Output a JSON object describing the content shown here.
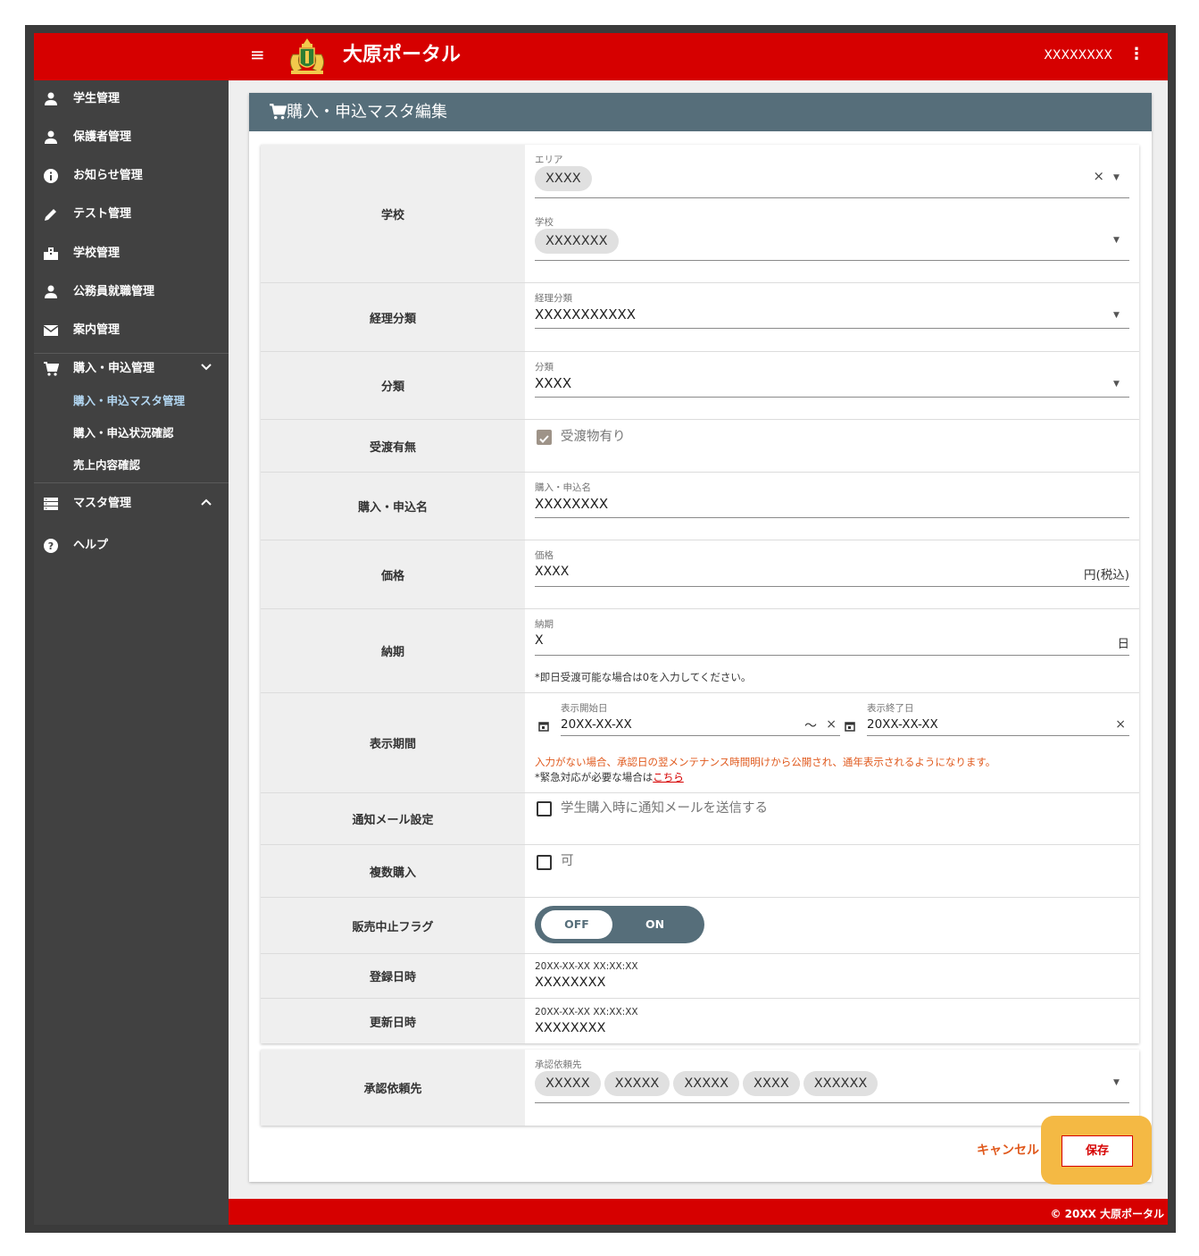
{
  "app": {
    "title": "大原ポータル",
    "user": "XXXXXXXX"
  },
  "sidebar": {
    "items": [
      {
        "label": "学生管理",
        "icon": "person-icon"
      },
      {
        "label": "保護者管理",
        "icon": "person-icon"
      },
      {
        "label": "お知らせ管理",
        "icon": "info-icon"
      },
      {
        "label": "テスト管理",
        "icon": "pencil-icon"
      },
      {
        "label": "学校管理",
        "icon": "building-icon"
      },
      {
        "label": "公務員就職管理",
        "icon": "person-icon"
      },
      {
        "label": "案内管理",
        "icon": "mail-icon"
      },
      {
        "label": "購入・申込管理",
        "icon": "cart-icon"
      },
      {
        "label": "マスタ管理",
        "icon": "list-icon"
      },
      {
        "label": "ヘルプ",
        "icon": "help-icon"
      }
    ],
    "sub_items": [
      "購入・申込マスタ管理",
      "購入・申込状況確認",
      "売上内容確認"
    ]
  },
  "page": {
    "title": "購入・申込マスタ編集"
  },
  "form": {
    "school": {
      "label": "学校",
      "area_caption": "エリア",
      "area_value": "XXXX",
      "school_caption": "学校",
      "school_value": "XXXXXXX"
    },
    "accounting": {
      "label": "経理分類",
      "caption": "経理分類",
      "value": "XXXXXXXXXXX"
    },
    "category": {
      "label": "分類",
      "caption": "分類",
      "value": "XXXX"
    },
    "delivery": {
      "label": "受渡有無",
      "checkbox_label": "受渡物有り",
      "checked": true
    },
    "name": {
      "label": "購入・申込名",
      "caption": "購入・申込名",
      "value": "XXXXXXXX"
    },
    "price": {
      "label": "価格",
      "caption": "価格",
      "value": "XXXX",
      "suffix": "円(税込)"
    },
    "deadline": {
      "label": "納期",
      "caption": "納期",
      "value": "X",
      "suffix": "日",
      "note": "*即日受渡可能な場合は0を入力してください。"
    },
    "display_period": {
      "label": "表示期間",
      "start_caption": "表示開始日",
      "start_value": "20XX-XX-XX",
      "separator": "～",
      "end_caption": "表示終了日",
      "end_value": "20XX-XX-XX",
      "warning": "入力がない場合、承認日の翌メンテナンス時間明けから公開され、通年表示されるようになります。",
      "emergency_prefix": "*緊急対応が必要な場合は",
      "emergency_link": "こちら"
    },
    "notify": {
      "label": "通知メール設定",
      "checkbox_label": "学生購入時に通知メールを送信する",
      "checked": false
    },
    "multiple": {
      "label": "複数購入",
      "checkbox_label": "可",
      "checked": false
    },
    "stop_flag": {
      "label": "販売中止フラグ",
      "off_label": "OFF",
      "on_label": "ON",
      "value": "OFF"
    },
    "created": {
      "label": "登録日時",
      "datetime": "20XX-XX-XX XX:XX:XX",
      "user": "XXXXXXXX"
    },
    "updated": {
      "label": "更新日時",
      "datetime": "20XX-XX-XX XX:XX:XX",
      "user": "XXXXXXXX"
    },
    "approval": {
      "label": "承認依頼先",
      "caption": "承認依頼先",
      "chips": [
        "XXXXX",
        "XXXXX",
        "XXXXX",
        "XXXX",
        "XXXXXX"
      ]
    }
  },
  "actions": {
    "cancel_label": "キャンセル",
    "save_label": "保存"
  },
  "footer": {
    "text": "© 20XX 大原ポータル"
  },
  "colors": {
    "brand_red": "#d60000",
    "header_slate": "#566e7a",
    "sidebar_bg": "#414141",
    "warning_orange": "#e05a1e",
    "highlight": "#f4b944"
  }
}
